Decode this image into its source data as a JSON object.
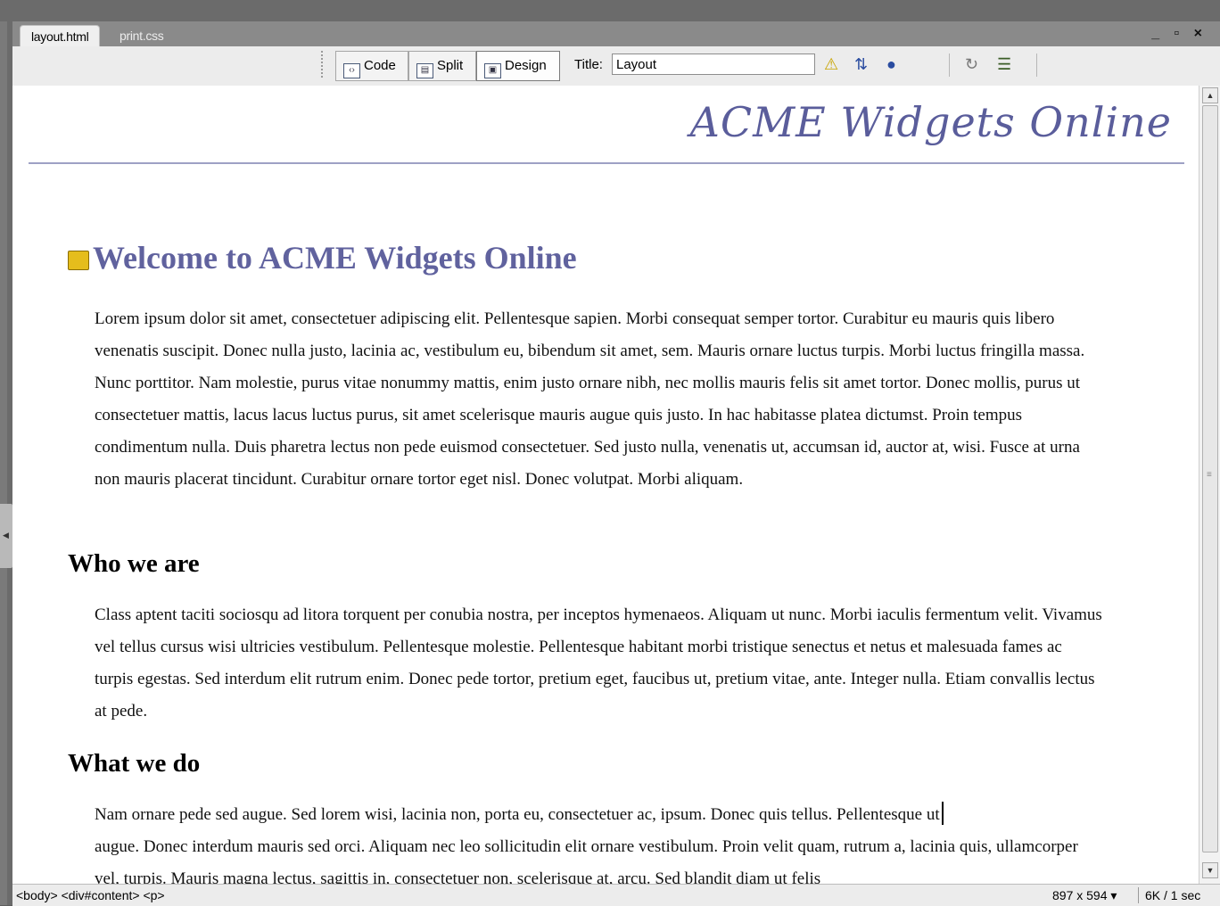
{
  "tabs": [
    "layout.html",
    "print.css"
  ],
  "window_controls": "_ ▫ ×",
  "toolbar": {
    "code": "Code",
    "split": "Split",
    "design": "Design",
    "title_label": "Title:",
    "title_value": "Layout"
  },
  "document": {
    "logo": "ACME Widgets Online",
    "heading": "Welcome to ACME Widgets Online",
    "intro": "Lorem ipsum dolor sit amet, consectetuer adipiscing elit. Pellentesque sapien. Morbi consequat semper tortor. Curabitur eu mauris quis libero venenatis suscipit. Donec nulla justo, lacinia ac, vestibulum eu, bibendum sit amet, sem. Mauris ornare luctus turpis. Morbi luctus fringilla massa. Nunc porttitor. Nam molestie, purus vitae nonummy mattis, enim justo ornare nibh, nec mollis mauris felis sit amet tortor. Donec mollis, purus ut consectetuer mattis, lacus lacus luctus purus, sit amet scelerisque mauris augue quis justo. In hac habitasse platea dictumst. Proin tempus condimentum nulla. Duis pharetra lectus non pede euismod consectetuer. Sed justo nulla, venenatis ut, accumsan id, auctor at, wisi. Fusce at urna non mauris placerat tincidunt. Curabitur ornare tortor eget nisl. Donec volutpat. Morbi aliquam.",
    "who_heading": "Who we are",
    "who_text": "Class aptent taciti sociosqu ad litora torquent per conubia nostra, per inceptos hymenaeos. Aliquam ut nunc. Morbi iaculis fermentum velit. Vivamus vel tellus cursus wisi ultricies vestibulum. Pellentesque molestie. Pellentesque habitant morbi tristique senectus et netus et malesuada fames ac turpis egestas. Sed interdum elit rutrum enim. Donec pede tortor, pretium eget, faucibus ut, pretium vitae, ante. Integer nulla. Etiam convallis lectus at pede.",
    "what_heading": "What we do",
    "what_text_1": "Nam ornare pede sed augue. Sed lorem wisi, lacinia non, porta eu, consectetuer ac, ipsum. Donec quis tellus. Pellentesque ut",
    "what_text_2": "augue. Donec interdum mauris sed orci. Aliquam nec leo sollicitudin elit ornare vestibulum. Proin velit quam, rutrum a, lacinia quis, ullamcorper vel, turpis. Mauris magna lectus, sagittis in, consectetuer non, scelerisque at, arcu. Sed blandit diam ut felis"
  },
  "status": {
    "tag_path": "<body> <div#content> <p>",
    "window_size": "897 x 594 ▾",
    "download": "6K / 1 sec"
  }
}
